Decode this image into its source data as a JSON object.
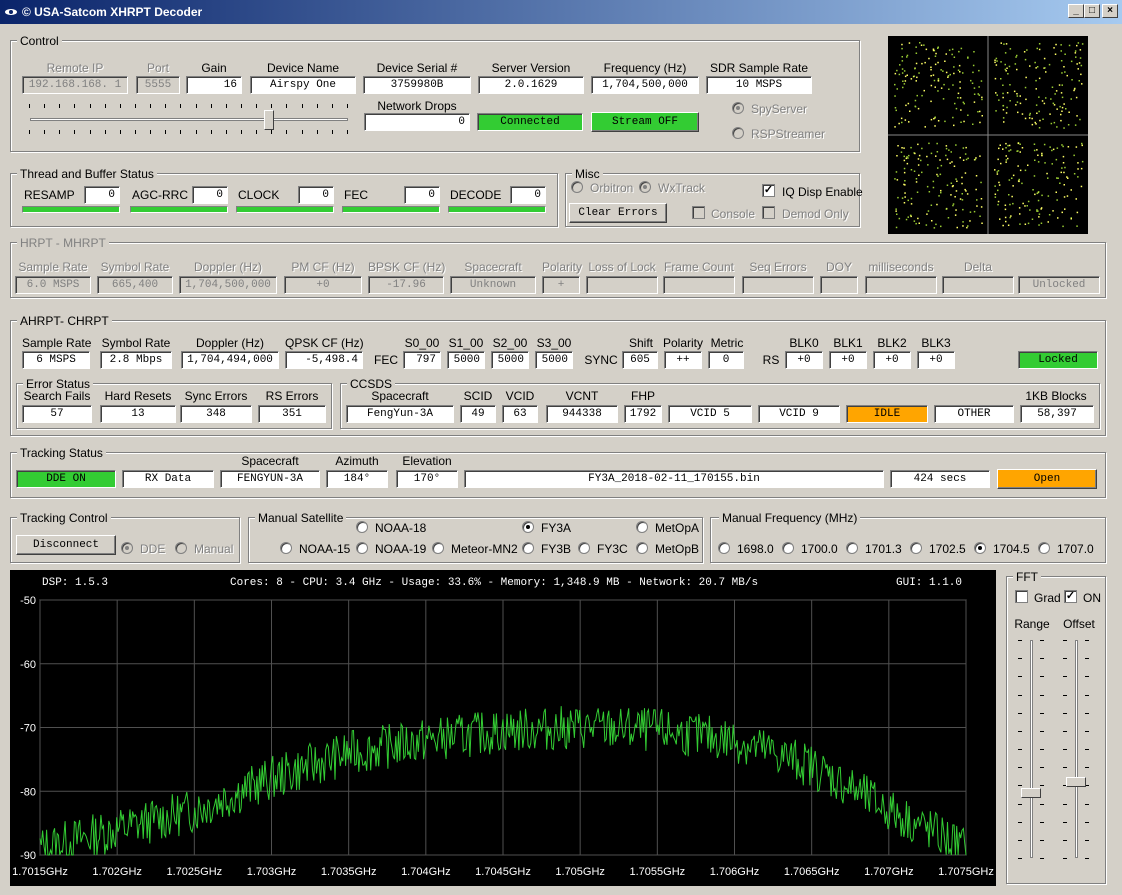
{
  "window": {
    "title": "© USA-Satcom XHRPT Decoder"
  },
  "control": {
    "title": "Control",
    "fields": [
      {
        "label": "Remote IP",
        "value": "192.168.168. 1",
        "disabled": true
      },
      {
        "label": "Port",
        "value": "5555",
        "disabled": true
      },
      {
        "label": "Gain",
        "value": "16"
      },
      {
        "label": "Device Name",
        "value": "Airspy One"
      },
      {
        "label": "Device Serial #",
        "value": "3759980B"
      },
      {
        "label": "Server Version",
        "value": "2.0.1629"
      },
      {
        "label": "Frequency (Hz)",
        "value": "1,704,500,000"
      },
      {
        "label": "SDR Sample Rate",
        "value": "10 MSPS"
      }
    ],
    "network_drops_label": "Network Drops",
    "network_drops": "0",
    "connected": "Connected",
    "stream_off": "Stream OFF",
    "spyserver": "SpyServer",
    "rspstreamer": "RSPStreamer"
  },
  "thread": {
    "title": "Thread and Buffer Status",
    "items": [
      {
        "label": "RESAMP",
        "value": "0"
      },
      {
        "label": "AGC-RRC",
        "value": "0"
      },
      {
        "label": "CLOCK",
        "value": "0"
      },
      {
        "label": "FEC",
        "value": "0"
      },
      {
        "label": "DECODE",
        "value": "0"
      }
    ]
  },
  "misc": {
    "title": "Misc",
    "orbitron": "Orbitron",
    "wxtrack": "WxTrack",
    "iq_disp": "IQ Disp Enable",
    "clear_errors": "Clear Errors",
    "console": "Console",
    "demod_only": "Demod Only"
  },
  "hrpt": {
    "title": "HRPT - MHRPT",
    "fields": [
      {
        "label": "Sample Rate",
        "value": "6.0 MSPS"
      },
      {
        "label": "Symbol Rate",
        "value": "665,400"
      },
      {
        "label": "Doppler (Hz)",
        "value": "1,704,500,000"
      },
      {
        "label": "PM CF (Hz)",
        "value": "+0"
      },
      {
        "label": "BPSK CF (Hz)",
        "value": "-17.96"
      },
      {
        "label": "Spacecraft",
        "value": "Unknown"
      },
      {
        "label": "Polarity",
        "value": "+"
      },
      {
        "label": "Loss of Lock",
        "value": ""
      },
      {
        "label": "Frame Count",
        "value": ""
      },
      {
        "label": "Seq Errors",
        "value": ""
      },
      {
        "label": "DOY",
        "value": ""
      },
      {
        "label": "milliseconds",
        "value": ""
      },
      {
        "label": "Delta",
        "value": ""
      },
      {
        "label": "",
        "value": "Unlocked"
      }
    ]
  },
  "ahrpt": {
    "title": "AHRPT- CHRPT",
    "sample_rate_label": "Sample Rate",
    "sample_rate": "6 MSPS",
    "symbol_rate_label": "Symbol Rate",
    "symbol_rate": "2.8 Mbps",
    "doppler_label": "Doppler (Hz)",
    "doppler": "1,704,494,000",
    "qpsk_label": "QPSK CF (Hz)",
    "qpsk": "-5,498.4",
    "fec_label": "FEC",
    "s_labels": [
      "S0_00",
      "S1_00",
      "S2_00",
      "S3_00"
    ],
    "s_values": [
      "797",
      "5000",
      "5000",
      "5000"
    ],
    "sync_label": "SYNC",
    "shift_label": "Shift",
    "shift": "605",
    "polarity_label": "Polarity",
    "polarity": "++",
    "metric_label": "Metric",
    "metric": "0",
    "rs_label": "RS",
    "blk_labels": [
      "BLK0",
      "BLK1",
      "BLK2",
      "BLK3"
    ],
    "blk_values": [
      "+0",
      "+0",
      "+0",
      "+0"
    ],
    "locked": "Locked"
  },
  "error_status": {
    "title": "Error Status",
    "fields": [
      {
        "label": "Search Fails",
        "value": "57"
      },
      {
        "label": "Hard Resets",
        "value": "13"
      },
      {
        "label": "Sync Errors",
        "value": "348"
      },
      {
        "label": "RS Errors",
        "value": "351"
      }
    ]
  },
  "ccsds": {
    "title": "CCSDS",
    "spacecraft_label": "Spacecraft",
    "spacecraft": "FengYun-3A",
    "scid_label": "SCID",
    "scid": "49",
    "vcid_label": "VCID",
    "vcid": "63",
    "vcnt_label": "VCNT",
    "vcnt": "944338",
    "fhp_label": "FHP",
    "fhp": "1792",
    "vcid5": "VCID 5",
    "vcid9": "VCID 9",
    "idle": "IDLE",
    "other": "OTHER",
    "blocks_label": "1KB Blocks",
    "blocks": "58,397"
  },
  "tracking": {
    "title": "Tracking Status",
    "dde_on": "DDE ON",
    "rx_data": "RX Data",
    "spacecraft_label": "Spacecraft",
    "spacecraft": "FENGYUN-3A",
    "azimuth_label": "Azimuth",
    "azimuth": "184°",
    "elevation_label": "Elevation",
    "elevation": "170°",
    "file": "FY3A_2018-02-11_170155.bin",
    "secs": "424 secs",
    "open": "Open"
  },
  "tracking_control": {
    "title": "Tracking Control",
    "disconnect": "Disconnect",
    "dde": "DDE",
    "manual": "Manual"
  },
  "manual_satellite": {
    "title": "Manual Satellite",
    "row1": [
      "NOAA-18",
      "FY3A",
      "MetOpA"
    ],
    "row2": [
      "NOAA-15",
      "NOAA-19",
      "Meteor-MN2",
      "FY3B",
      "FY3C",
      "MetOpB"
    ],
    "selected": "FY3A"
  },
  "manual_frequency": {
    "title": "Manual Frequency (MHz)",
    "options": [
      "1698.0",
      "1700.0",
      "1701.3",
      "1702.5",
      "1704.5",
      "1707.0"
    ],
    "selected": "1704.5"
  },
  "spectrum": {
    "dsp": "DSP: 1.5.3",
    "status": "Cores:  8 - CPU: 3.4 GHz - Usage:  33.6% - Memory: 1,348.9 MB - Network: 20.7 MB/s",
    "gui": "GUI: 1.1.0"
  },
  "chart_data": {
    "type": "line",
    "y_ticks": [
      "-50",
      "-60",
      "-70",
      "-80",
      "-90"
    ],
    "ylim": [
      -90,
      -50
    ],
    "x_ticks": [
      "1.7015GHz",
      "1.702GHz",
      "1.7025GHz",
      "1.703GHz",
      "1.7035GHz",
      "1.704GHz",
      "1.7045GHz",
      "1.705GHz",
      "1.7055GHz",
      "1.706GHz",
      "1.7065GHz",
      "1.707GHz",
      "1.7075GHz"
    ],
    "xlim": [
      1.7015,
      1.7075
    ],
    "grid": true,
    "series": [
      {
        "color": "#33cc33",
        "x": [
          1.7015,
          1.702,
          1.7025,
          1.703,
          1.7035,
          1.704,
          1.7045,
          1.705,
          1.7055,
          1.706,
          1.7065,
          1.707,
          1.7075
        ],
        "values": [
          -89,
          -86,
          -83,
          -78,
          -74,
          -72,
          -70.5,
          -70,
          -70.5,
          -72,
          -76,
          -83,
          -89
        ]
      }
    ]
  },
  "fft": {
    "title": "FFT",
    "grad": "Grad",
    "on": "ON",
    "range": "Range",
    "offset": "Offset",
    "range_level": 0.3,
    "offset_level": 0.35
  }
}
